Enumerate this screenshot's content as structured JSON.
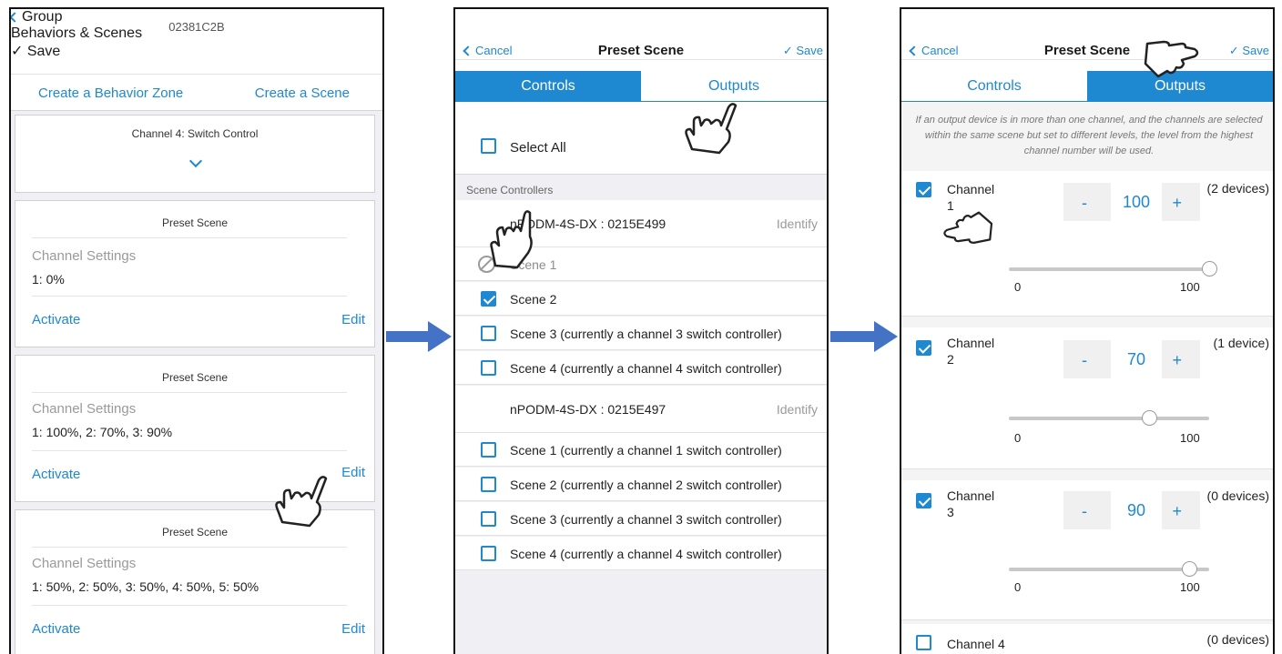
{
  "screen1": {
    "device_id": "02381C2B",
    "back_label": "Group",
    "title": "Behaviors & Scenes",
    "save_label": "✓ Save",
    "create_zone": "Create a Behavior Zone",
    "create_scene": "Create a Scene",
    "channel_card_title": "Channel 4: Switch Control",
    "scenes": [
      {
        "title": "Preset Scene",
        "settings_label": "Channel Settings",
        "settings_value": "1: 0%",
        "activate": "Activate",
        "edit": "Edit"
      },
      {
        "title": "Preset Scene",
        "settings_label": "Channel Settings",
        "settings_value": "1: 100%, 2: 70%, 3: 90%",
        "activate": "Activate",
        "edit": "Edit"
      },
      {
        "title": "Preset Scene",
        "settings_label": "Channel Settings",
        "settings_value": "1: 50%, 2: 50%, 3: 50%, 4: 50%, 5: 50%",
        "activate": "Activate",
        "edit": "Edit"
      }
    ]
  },
  "screen2": {
    "cancel_label": "Cancel",
    "title": "Preset Scene",
    "save_label": "✓ Save",
    "tab_controls": "Controls",
    "tab_outputs": "Outputs",
    "select_all": "Select All",
    "section_label": "Scene Controllers",
    "controllers": [
      {
        "name": "nPODM-4S-DX : 0215E499",
        "identify": "Identify",
        "scenes": [
          {
            "label": "Scene 1",
            "state": "disabled"
          },
          {
            "label": "Scene 2",
            "state": "checked"
          },
          {
            "label": "Scene 3 (currently a channel 3 switch controller)",
            "state": "unchecked"
          },
          {
            "label": "Scene 4 (currently a channel 4 switch controller)",
            "state": "unchecked"
          }
        ]
      },
      {
        "name": "nPODM-4S-DX : 0215E497",
        "identify": "Identify",
        "scenes": [
          {
            "label": "Scene 1 (currently a channel 1 switch controller)",
            "state": "unchecked"
          },
          {
            "label": "Scene 2 (currently a channel 2 switch controller)",
            "state": "unchecked"
          },
          {
            "label": "Scene 3 (currently a channel 3 switch controller)",
            "state": "unchecked"
          },
          {
            "label": "Scene 4 (currently a channel 4 switch controller)",
            "state": "unchecked"
          }
        ]
      }
    ]
  },
  "screen3": {
    "cancel_label": "Cancel",
    "title": "Preset Scene",
    "save_label": "✓ Save",
    "tab_controls": "Controls",
    "tab_outputs": "Outputs",
    "note": "If an output device is in more than one channel, and the channels are selected within the same scene but set to different levels, the level from the highest channel number will be used.",
    "channels": [
      {
        "line1": "Channel",
        "line2": "1",
        "devices": "(2 devices)",
        "value": "100",
        "level": 1.0,
        "min": "0",
        "max": "100",
        "checked": true
      },
      {
        "line1": "Channel",
        "line2": "2",
        "devices": "(1 device)",
        "value": "70",
        "level": 0.7,
        "min": "0",
        "max": "100",
        "checked": true
      },
      {
        "line1": "Channel",
        "line2": "3",
        "devices": "(0 devices)",
        "value": "90",
        "level": 0.9,
        "min": "0",
        "max": "100",
        "checked": true
      },
      {
        "line1": "Channel 4",
        "devices": "(0 devices)",
        "checked": false
      }
    ],
    "stepper_minus": "-",
    "stepper_plus": "+"
  },
  "colors": {
    "accent": "#1e88d0",
    "arrow": "#4472c4"
  }
}
